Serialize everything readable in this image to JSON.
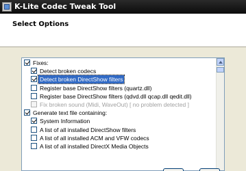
{
  "window": {
    "title": "K-Lite Codec Tweak Tool"
  },
  "header": {
    "title": "Select Options"
  },
  "options": [
    {
      "label": "Fixes:",
      "checked": true,
      "disabled": false,
      "selected": false,
      "level": 0
    },
    {
      "label": "Detect broken codecs",
      "checked": true,
      "disabled": false,
      "selected": false,
      "level": 1
    },
    {
      "label": "Detect broken DirectShow filters",
      "checked": true,
      "disabled": false,
      "selected": true,
      "level": 1
    },
    {
      "label": "Register base DirectShow filters (quartz.dll)",
      "checked": false,
      "disabled": false,
      "selected": false,
      "level": 1
    },
    {
      "label": "Register base DirectShow filters (qdvd.dll qcap.dll qedit.dll)",
      "checked": false,
      "disabled": false,
      "selected": false,
      "level": 1
    },
    {
      "label": "Fix broken sound  (Midi, WaveOut)   [ no problem detected ]",
      "checked": false,
      "disabled": true,
      "selected": false,
      "level": 1
    },
    {
      "label": "Generate text file containing:",
      "checked": true,
      "disabled": false,
      "selected": false,
      "level": 0
    },
    {
      "label": "System Information",
      "checked": true,
      "disabled": false,
      "selected": false,
      "level": 1
    },
    {
      "label": "A list of all installed DirectShow filters",
      "checked": false,
      "disabled": false,
      "selected": false,
      "level": 1
    },
    {
      "label": "A list of all installed ACM and VFW codecs",
      "checked": false,
      "disabled": false,
      "selected": false,
      "level": 1
    },
    {
      "label": "A list of all installed DirectX Media Objects",
      "checked": false,
      "disabled": false,
      "selected": false,
      "level": 1
    }
  ],
  "colors": {
    "titlebar": "#1a1a1a",
    "selection": "#316ac5",
    "face": "#ece9d8"
  }
}
